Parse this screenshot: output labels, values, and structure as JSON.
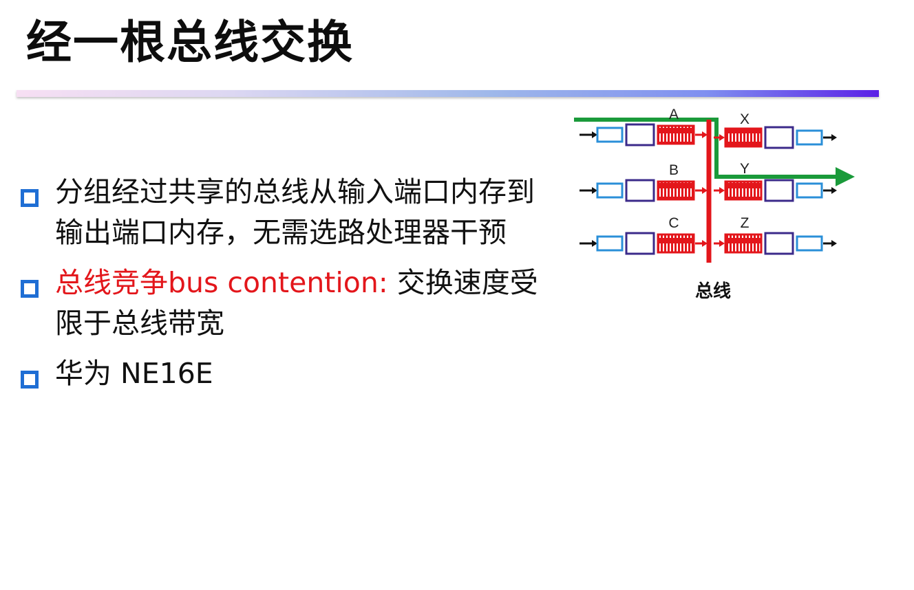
{
  "slide": {
    "title": "经一根总线交换"
  },
  "bullets": [
    {
      "text": "分组经过共享的总线从输入端口内存到输出端口内存，无需选路处理器干预"
    },
    {
      "highlight": "总线竞争bus contention:",
      "text": " 交换速度受限于总线带宽"
    },
    {
      "text": "华为 NE16E"
    }
  ],
  "diagram": {
    "input_ports": [
      "A",
      "B",
      "C"
    ],
    "output_ports": [
      "X",
      "Y",
      "Z"
    ],
    "caption": "总线",
    "colors": {
      "bus": "#e3161b",
      "path": "#1a9a3a",
      "buffer": "#e3161b",
      "port_outer": "#2a8fd8",
      "port_inner": "#3b2a8a"
    }
  },
  "colors": {
    "bullet_marker": "#1f6ed4",
    "highlight_text": "#e3161b"
  }
}
